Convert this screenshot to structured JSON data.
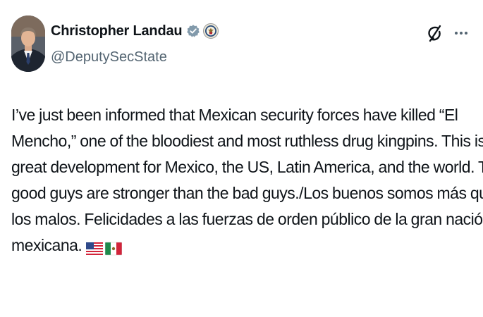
{
  "author": {
    "display_name": "Christopher Landau",
    "handle": "@DeputySecState",
    "verified_badge": "verified-gray-badge-icon",
    "affiliation_badge": "department-of-state-seal-icon"
  },
  "header_actions": {
    "grok_icon": "grok-icon",
    "more_icon": "more-options-icon"
  },
  "tweet": {
    "lines": [
      "I’ve just been informed that Mexican security forces have killed “El",
      "Mencho,” one of the bloodiest and most ruthless drug kingpins. This is a",
      "great development for Mexico, the US, Latin America, and the world. The",
      "good guys are stronger than the bad guys./Los buenos somos más que",
      "los malos. Felicidades a las fuerzas de orden público de la gran nación",
      "mexicana."
    ],
    "emoji": [
      "us-flag-emoji",
      "mexico-flag-emoji"
    ]
  },
  "colors": {
    "primary_text": "#0f1419",
    "secondary_text": "#536471",
    "verified_gray": "#829aab"
  }
}
